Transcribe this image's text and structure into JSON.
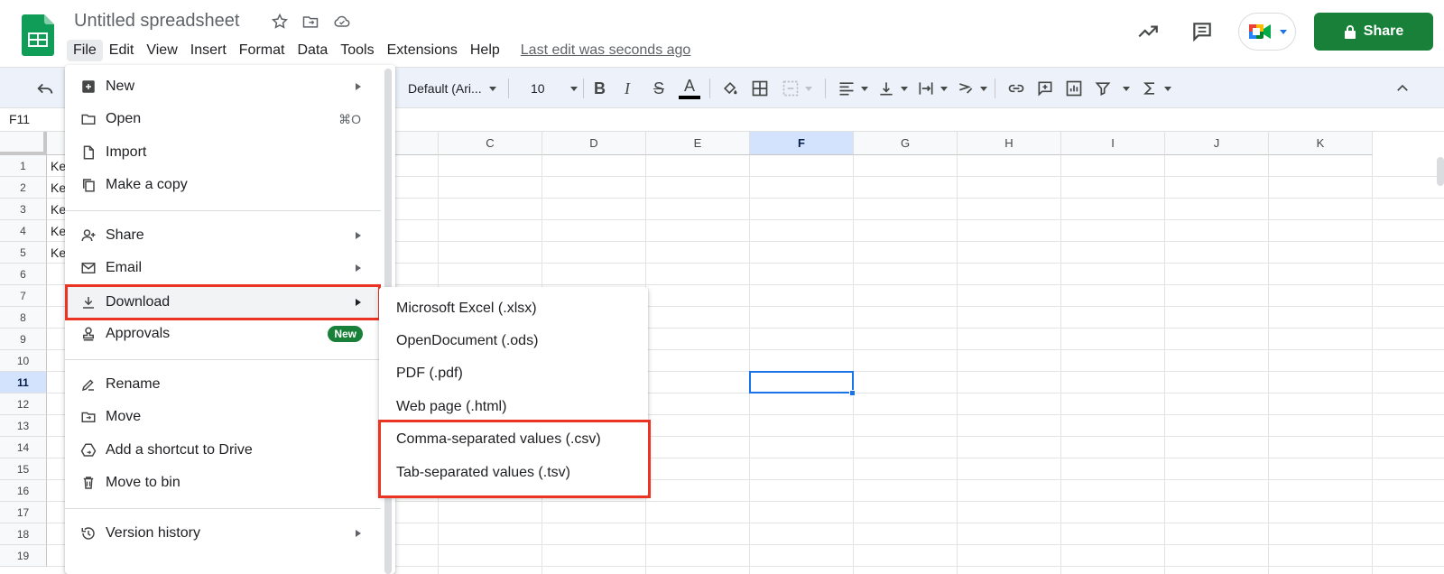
{
  "app": {
    "title": "Untitled spreadsheet",
    "last_edit": "Last edit was seconds ago",
    "menus": [
      "File",
      "Edit",
      "View",
      "Insert",
      "Format",
      "Data",
      "Tools",
      "Extensions",
      "Help"
    ],
    "active_menu": "File",
    "share_label": "Share"
  },
  "toolbar": {
    "font": "Default (Ari...",
    "font_size": "10",
    "bold_label": "B",
    "italic_label": "I",
    "strike_label": "S",
    "text_color_label": "A",
    "text_color": "#000000"
  },
  "formula_bar": {
    "name_box": "F11"
  },
  "grid": {
    "columns": [
      "C",
      "D",
      "E",
      "F",
      "G",
      "H",
      "I",
      "J",
      "K"
    ],
    "selected_column": "F",
    "rows": [
      "1",
      "2",
      "3",
      "4",
      "5",
      "6",
      "7",
      "8",
      "9",
      "10",
      "11",
      "12",
      "13",
      "14",
      "15",
      "16",
      "17",
      "18",
      "19"
    ],
    "selected_row": "11",
    "column_a_values": [
      "Ke",
      "Ke",
      "Ke",
      "Ke",
      "Ke"
    ]
  },
  "file_menu": {
    "items": [
      {
        "label": "New",
        "icon": "new-sheet-icon",
        "submenu": true
      },
      {
        "label": "Open",
        "icon": "folder-icon",
        "shortcut": "⌘O"
      },
      {
        "label": "Import",
        "icon": "file-icon"
      },
      {
        "label": "Make a copy",
        "icon": "copy-icon"
      },
      {
        "label": "Share",
        "icon": "person-add-icon",
        "submenu": true
      },
      {
        "label": "Email",
        "icon": "mail-icon",
        "submenu": true
      },
      {
        "label": "Download",
        "icon": "download-icon",
        "submenu": true
      },
      {
        "label": "Approvals",
        "icon": "stamp-icon",
        "badge": "New"
      },
      {
        "label": "Rename",
        "icon": "rename-icon"
      },
      {
        "label": "Move",
        "icon": "move-folder-icon"
      },
      {
        "label": "Add a shortcut to Drive",
        "icon": "drive-shortcut-icon"
      },
      {
        "label": "Move to bin",
        "icon": "trash-icon"
      },
      {
        "label": "Version history",
        "icon": "history-icon",
        "submenu": true
      }
    ]
  },
  "download_submenu": {
    "items": [
      "Microsoft Excel (.xlsx)",
      "OpenDocument (.ods)",
      "PDF (.pdf)",
      "Web page (.html)",
      "Comma-separated values (.csv)",
      "Tab-separated values (.tsv)"
    ]
  },
  "colors": {
    "share_green": "#188038",
    "highlight_red": "#ea3323",
    "selection_blue": "#1a73e8",
    "toolbar_bg": "#edf2fa"
  }
}
